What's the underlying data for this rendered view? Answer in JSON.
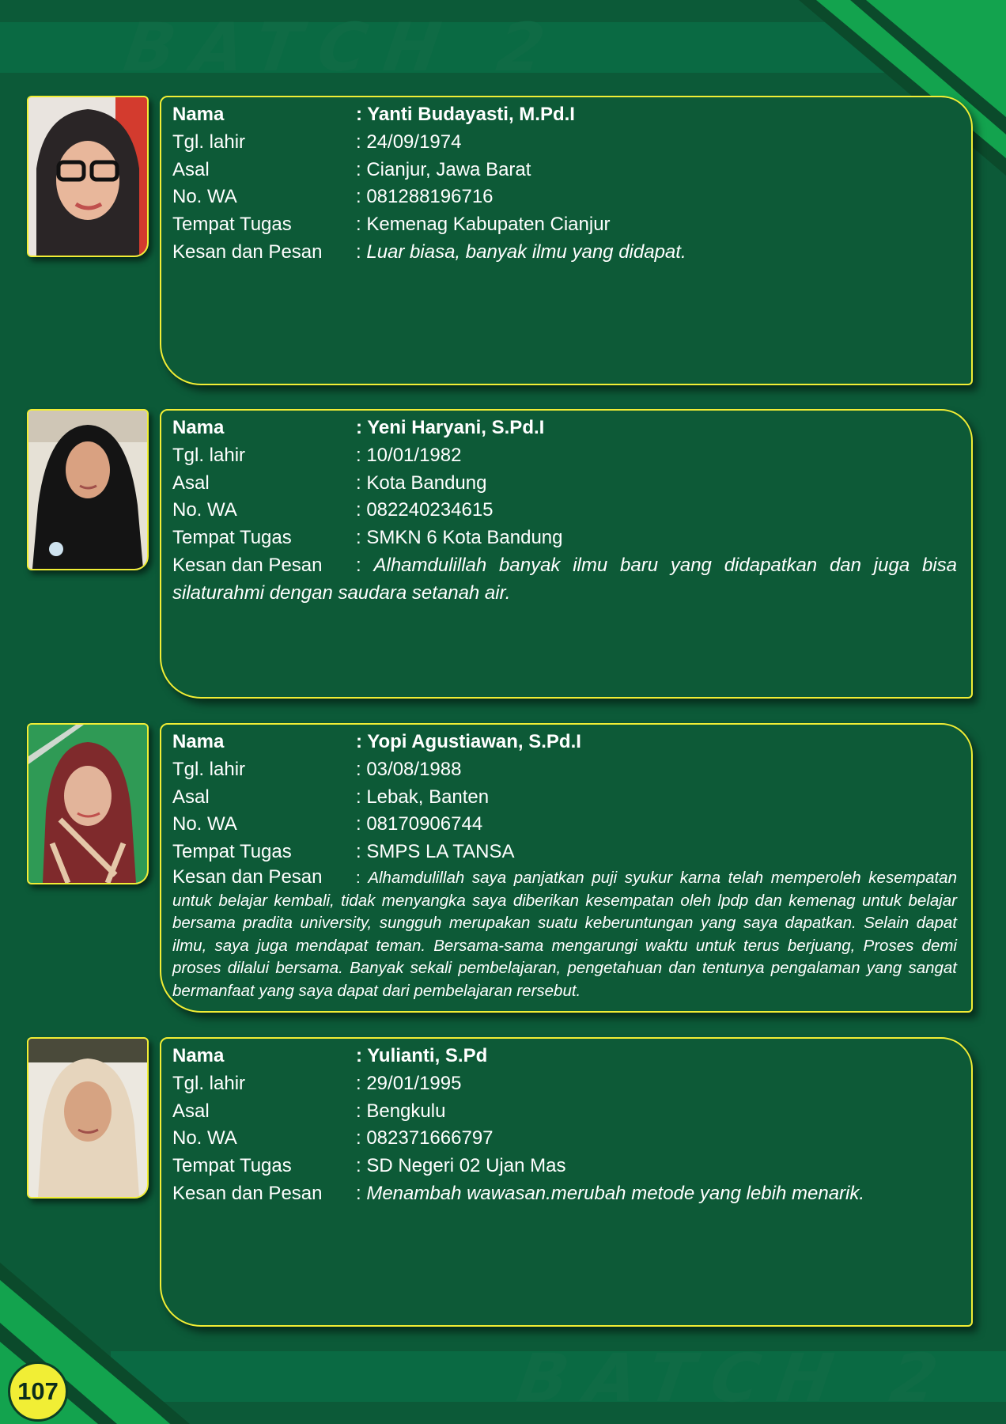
{
  "header": {
    "batch_label": "BATCH 2"
  },
  "footer": {
    "batch_label": "BATCH 2",
    "page_number": "107"
  },
  "labels": {
    "nama": "Nama",
    "tgl_lahir": "Tgl. lahir",
    "asal": "Asal",
    "no_wa": "No. WA",
    "tempat_tugas": "Tempat Tugas",
    "kesan_pesan": "Kesan dan Pesan"
  },
  "entries": [
    {
      "nama": ": Yanti Budayasti, M.Pd.I",
      "tgl_lahir": ": 24/09/1974",
      "asal": ": Cianjur, Jawa Barat",
      "no_wa": ": 081288196716",
      "tempat_tugas": ": Kemenag Kabupaten Cianjur",
      "kesan_pesan": "Luar biasa, banyak ilmu yang didapat."
    },
    {
      "nama": ": Yeni Haryani, S.Pd.I",
      "tgl_lahir": ": 10/01/1982",
      "asal": ": Kota Bandung",
      "no_wa": ": 082240234615",
      "tempat_tugas": ": SMKN 6 Kota Bandung",
      "kesan_pesan": "Alhamdulillah  banyak ilmu baru yang didapatkan dan juga bisa silaturahmi dengan saudara setanah air."
    },
    {
      "nama": ": Yopi Agustiawan, S.Pd.I",
      "tgl_lahir": ": 03/08/1988",
      "asal": ": Lebak, Banten",
      "no_wa": ": 08170906744",
      "tempat_tugas": ": SMPS LA TANSA",
      "kesan_pesan": "Alhamdulillah saya panjatkan puji syukur karna telah memperoleh kesempatan untuk belajar kembali, tidak menyangka saya diberikan kesempatan oleh lpdp dan kemenag untuk belajar bersama pradita university, sungguh merupakan suatu keberuntungan yang saya dapatkan. Selain dapat ilmu, saya juga mendapat teman. Bersama-sama mengarungi waktu untuk terus berjuang, Proses demi proses dilalui bersama. Banyak sekali pembelajaran, pengetahuan dan tentunya pengalaman yang sangat bermanfaat yang saya dapat dari pembelajaran rersebut."
    },
    {
      "nama": ": Yulianti, S.Pd",
      "tgl_lahir": ": 29/01/1995",
      "asal": ": Bengkulu",
      "no_wa": ": 082371666797",
      "tempat_tugas": ": SD Negeri 02 Ujan Mas",
      "kesan_pesan": "Menambah wawasan.merubah metode yang lebih menarik."
    }
  ],
  "colors": {
    "background": "#0c5a38",
    "accent_yellow": "#f1ee35",
    "band": "#0a6a43",
    "stripe_green": "#13a34e"
  }
}
